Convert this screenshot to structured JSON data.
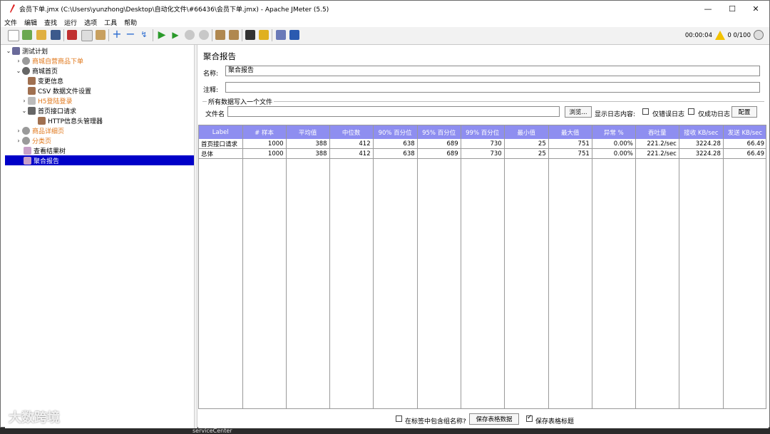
{
  "window": {
    "title": "会员下单.jmx (C:\\Users\\yunzhong\\Desktop\\自动化文件\\#66436\\会员下单.jmx) - Apache JMeter (5.5)",
    "min": "—",
    "max": "☐",
    "close": "✕"
  },
  "menu": [
    "文件",
    "编辑",
    "查找",
    "运行",
    "选项",
    "工具",
    "帮助"
  ],
  "toolbar": {
    "timer": "00:00:04",
    "warn_count": "0",
    "threads": "0/100"
  },
  "tree": [
    {
      "label": "测试计划",
      "toggle": "⌄"
    },
    {
      "label": "商城自营商品下单",
      "toggle": "›"
    },
    {
      "label": "商城首页",
      "toggle": "⌄"
    },
    {
      "label": "变更信息",
      "toggle": ""
    },
    {
      "label": "CSV 数据文件设置",
      "toggle": ""
    },
    {
      "label": "H5登陆登录",
      "toggle": "›"
    },
    {
      "label": "首页接口请求",
      "toggle": "⌄"
    },
    {
      "label": "HTTP信息头管理器",
      "toggle": ""
    },
    {
      "label": "商品详细页",
      "toggle": "›"
    },
    {
      "label": "分类页",
      "toggle": "›"
    },
    {
      "label": "查看结果树",
      "toggle": ""
    },
    {
      "label": "聚合报告",
      "toggle": ""
    }
  ],
  "panel": {
    "title": "聚合报告",
    "name_label": "名称:",
    "name_value": "聚合报告",
    "comment_label": "注释:",
    "comment_value": "",
    "fieldset_label": "所有数据写入一个文件",
    "file_label": "文件名",
    "file_value": "",
    "browse_button": "浏览...",
    "log_label": "显示日志内容:",
    "errors_only": "仅错误日志",
    "success_only": "仅成功日志",
    "config_button": "配置"
  },
  "table": {
    "columns": [
      "Label",
      "# 样本",
      "平均值",
      "中位数",
      "90% 百分位",
      "95% 百分位",
      "99% 百分位",
      "最小值",
      "最大值",
      "异常 %",
      "吞吐量",
      "接收 KB/sec",
      "发送 KB/sec"
    ],
    "rows": [
      [
        "首页接口请求",
        "1000",
        "388",
        "412",
        "638",
        "689",
        "730",
        "25",
        "751",
        "0.00%",
        "221.2/sec",
        "3224.28",
        "66.49"
      ],
      [
        "总体",
        "1000",
        "388",
        "412",
        "638",
        "689",
        "730",
        "25",
        "751",
        "0.00%",
        "221.2/sec",
        "3224.28",
        "66.49"
      ]
    ]
  },
  "bottom": {
    "include_group": "在标签中包含组名称?",
    "save_table": "保存表格数据",
    "save_header": "保存表格标题"
  },
  "watermark": "大数跨境",
  "background_text": "serviceCenter"
}
